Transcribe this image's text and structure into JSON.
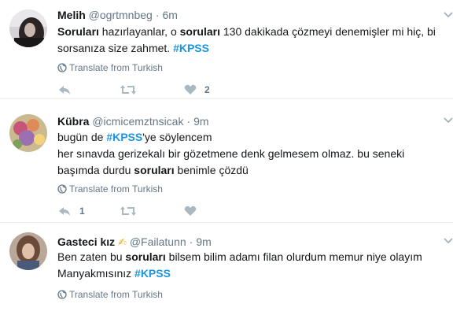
{
  "tweets": [
    {
      "name": "Melih",
      "screen_name": "@ogrtmnbeg",
      "separator": "·",
      "time": "6m",
      "emoji": "",
      "lines": [
        [
          {
            "t": "Soruları",
            "s": "b"
          },
          {
            "t": " hazırlayanlar, o "
          },
          {
            "t": "soruları",
            "s": "b"
          },
          {
            "t": " 130 dakikada çözmeyi denemişler mi hiç, bi"
          }
        ],
        [
          {
            "t": "sorsanıza size zahmet. "
          },
          {
            "t": "#KPSS",
            "s": "tag"
          }
        ]
      ],
      "translate_label": "Translate from Turkish",
      "reply_count": "",
      "retweet_count": "",
      "like_count": "2"
    },
    {
      "name": "Kübra",
      "screen_name": "@icmicemztnsicak",
      "separator": "·",
      "time": "9m",
      "emoji": "",
      "lines": [
        [
          {
            "t": "bugün de "
          },
          {
            "t": "#KPSS",
            "s": "tag"
          },
          {
            "t": "'ye söylencem"
          }
        ],
        [
          {
            "t": "her sınavda gerizekalı bir gözetmene denk gelmesem olmaz. bu seneki"
          }
        ],
        [
          {
            "t": "başımda durdu "
          },
          {
            "t": "soruları",
            "s": "b"
          },
          {
            "t": " benimle çözdü"
          }
        ]
      ],
      "translate_label": "Translate from Turkish",
      "reply_count": "1",
      "retweet_count": "",
      "like_count": ""
    },
    {
      "name": "Gasteci kız",
      "screen_name": "@Failatunn",
      "separator": "·",
      "time": "9m",
      "emoji": "✍",
      "lines": [
        [
          {
            "t": "Ben zaten bu "
          },
          {
            "t": "soruları",
            "s": "b"
          },
          {
            "t": " bilsem bilim adamı filan olurdum memur niye olayım"
          }
        ],
        [
          {
            "t": "Manyakmısınız "
          },
          {
            "t": "#KPSS",
            "s": "tag"
          }
        ]
      ],
      "translate_label": "Translate from Turkish",
      "reply_count": "",
      "retweet_count": "",
      "like_count": ""
    }
  ],
  "icons": {
    "globe": "globe-icon",
    "reply": "reply-icon",
    "retweet": "retweet-icon",
    "like": "heart-icon",
    "caret": "chevron-down-icon"
  },
  "colors": {
    "hashtag": "#1b95e0",
    "muted": "#657786",
    "divider": "#e6ecf0",
    "text": "#14171a"
  }
}
